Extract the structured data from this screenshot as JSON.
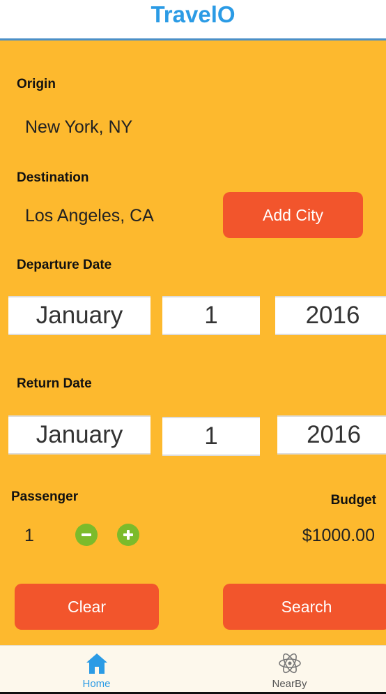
{
  "app": {
    "title": "TravelO"
  },
  "form": {
    "origin_label": "Origin",
    "origin_value": "New York, NY",
    "destination_label": "Destination",
    "destination_value": "Los Angeles, CA",
    "add_city_label": "Add City",
    "departure_label": "Departure Date",
    "departure": {
      "month": "January",
      "day": "1",
      "year": "2016"
    },
    "return_label": "Return Date",
    "return": {
      "month": "January",
      "day": "1",
      "year": "2016"
    },
    "passenger_label": "Passenger",
    "passenger_value": "1",
    "budget_label": "Budget",
    "budget_value": "$1000.00",
    "clear_label": "Clear",
    "search_label": "Search"
  },
  "tabs": [
    {
      "label": "Home",
      "icon": "home-icon",
      "active": true
    },
    {
      "label": "NearBy",
      "icon": "atom-icon",
      "active": false
    }
  ],
  "colors": {
    "accent": "#2b9be5",
    "background": "#fdb92e",
    "button": "#f2552c",
    "stepper": "#7cbb2b"
  }
}
